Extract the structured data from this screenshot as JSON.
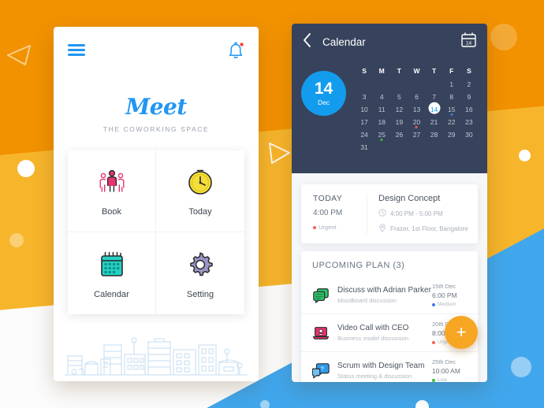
{
  "background": {
    "orange": "#F29200",
    "yellow": "#F7B52C",
    "white": "#FCFCFC",
    "blue": "#41A7ED"
  },
  "left_phone": {
    "menu_icon": "hamburger-icon",
    "bell_icon": "bell-icon",
    "has_notification": true,
    "brand": "Meet",
    "tagline": "THE COWORKING SPACE",
    "menu": [
      {
        "label": "Book",
        "icon": "people-icon",
        "color": "#E8336E"
      },
      {
        "label": "Today",
        "icon": "clock-icon",
        "color": "#F5DE3A"
      },
      {
        "label": "Calendar",
        "icon": "calendar-icon",
        "color": "#24D0C4"
      },
      {
        "label": "Setting",
        "icon": "gear-icon",
        "color": "#9A96C8"
      }
    ],
    "skyline_illustration": "city-skyline"
  },
  "right_phone": {
    "back_icon": "chevron-left-icon",
    "title": "Calendar",
    "calendar_icon": "calendar-icon",
    "selected_day": "14",
    "selected_month": "Dec",
    "dow": [
      "S",
      "M",
      "T",
      "W",
      "T",
      "F",
      "S"
    ],
    "days": [
      "",
      "",
      "",
      "",
      "",
      "1",
      "2",
      "3",
      "4",
      "5",
      "6",
      "7",
      "8",
      "9",
      "10",
      "11",
      "12",
      "13",
      "14",
      "15",
      "16",
      "17",
      "18",
      "19",
      "20",
      "21",
      "22",
      "23",
      "24",
      "25",
      "26",
      "27",
      "28",
      "29",
      "30",
      "31",
      "",
      "",
      "",
      "",
      "",
      ""
    ],
    "selected_index": 18,
    "day_dots": {
      "15": "#3E7BE8",
      "20": "#F25F5C",
      "25": "#3CC13B"
    },
    "today_card": {
      "label": "TODAY",
      "time": "4:00 PM",
      "priority": "Urgent",
      "priority_color": "#F25F5C",
      "event_title": "Design Concept",
      "event_time": "4:00 PM - 5:00 PM",
      "event_location": "Frazer, 1st Floor, Bangalore",
      "clock_icon": "clock-icon",
      "pin_icon": "location-pin-icon"
    },
    "upcoming": {
      "title": "UPCOMING PLAN (3)",
      "items": [
        {
          "title": "Discuss with Adrian Parker",
          "subtitle": "Moodboard discussion",
          "date": "15th Dec",
          "time": "6:00 PM",
          "priority": "Medium",
          "priority_color": "#3E7BE8",
          "icon": "chat-messages-icon",
          "icon_color": "#2EC06A"
        },
        {
          "title": "Video Call with CEO",
          "subtitle": "Business model discussion",
          "date": "20th Dec",
          "time": "8:00 PM",
          "priority": "Urgent",
          "priority_color": "#F25F5C",
          "icon": "laptop-video-icon",
          "icon_color": "#E8336E"
        },
        {
          "title": "Scrum with Design Team",
          "subtitle": "Status meeting & discussion",
          "date": "25th Dec",
          "time": "10:00 AM",
          "priority": "Low",
          "priority_color": "#3CC13B",
          "icon": "chat-bubbles-icon",
          "icon_color": "#2E9BEA"
        }
      ]
    },
    "fab_label": "+"
  }
}
